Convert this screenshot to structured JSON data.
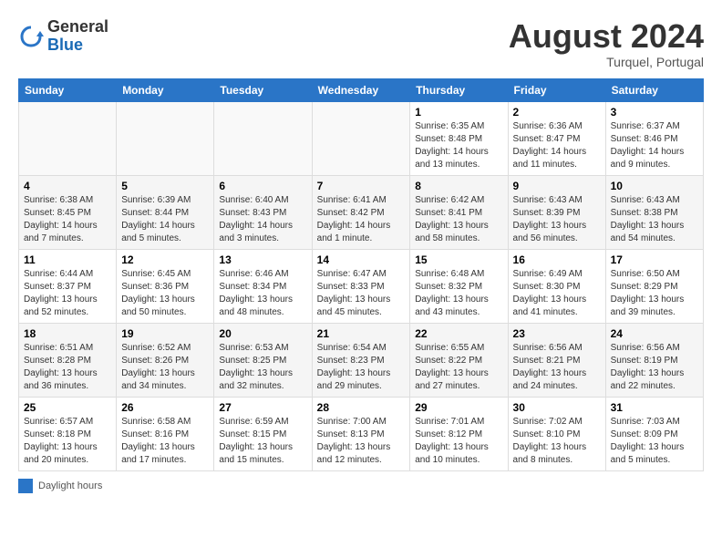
{
  "header": {
    "logo_line1": "General",
    "logo_line2": "Blue",
    "month_year": "August 2024",
    "location": "Turquel, Portugal"
  },
  "calendar": {
    "days_of_week": [
      "Sunday",
      "Monday",
      "Tuesday",
      "Wednesday",
      "Thursday",
      "Friday",
      "Saturday"
    ],
    "weeks": [
      [
        {
          "num": "",
          "info": ""
        },
        {
          "num": "",
          "info": ""
        },
        {
          "num": "",
          "info": ""
        },
        {
          "num": "",
          "info": ""
        },
        {
          "num": "1",
          "info": "Sunrise: 6:35 AM\nSunset: 8:48 PM\nDaylight: 14 hours and 13 minutes."
        },
        {
          "num": "2",
          "info": "Sunrise: 6:36 AM\nSunset: 8:47 PM\nDaylight: 14 hours and 11 minutes."
        },
        {
          "num": "3",
          "info": "Sunrise: 6:37 AM\nSunset: 8:46 PM\nDaylight: 14 hours and 9 minutes."
        }
      ],
      [
        {
          "num": "4",
          "info": "Sunrise: 6:38 AM\nSunset: 8:45 PM\nDaylight: 14 hours and 7 minutes."
        },
        {
          "num": "5",
          "info": "Sunrise: 6:39 AM\nSunset: 8:44 PM\nDaylight: 14 hours and 5 minutes."
        },
        {
          "num": "6",
          "info": "Sunrise: 6:40 AM\nSunset: 8:43 PM\nDaylight: 14 hours and 3 minutes."
        },
        {
          "num": "7",
          "info": "Sunrise: 6:41 AM\nSunset: 8:42 PM\nDaylight: 14 hours and 1 minute."
        },
        {
          "num": "8",
          "info": "Sunrise: 6:42 AM\nSunset: 8:41 PM\nDaylight: 13 hours and 58 minutes."
        },
        {
          "num": "9",
          "info": "Sunrise: 6:43 AM\nSunset: 8:39 PM\nDaylight: 13 hours and 56 minutes."
        },
        {
          "num": "10",
          "info": "Sunrise: 6:43 AM\nSunset: 8:38 PM\nDaylight: 13 hours and 54 minutes."
        }
      ],
      [
        {
          "num": "11",
          "info": "Sunrise: 6:44 AM\nSunset: 8:37 PM\nDaylight: 13 hours and 52 minutes."
        },
        {
          "num": "12",
          "info": "Sunrise: 6:45 AM\nSunset: 8:36 PM\nDaylight: 13 hours and 50 minutes."
        },
        {
          "num": "13",
          "info": "Sunrise: 6:46 AM\nSunset: 8:34 PM\nDaylight: 13 hours and 48 minutes."
        },
        {
          "num": "14",
          "info": "Sunrise: 6:47 AM\nSunset: 8:33 PM\nDaylight: 13 hours and 45 minutes."
        },
        {
          "num": "15",
          "info": "Sunrise: 6:48 AM\nSunset: 8:32 PM\nDaylight: 13 hours and 43 minutes."
        },
        {
          "num": "16",
          "info": "Sunrise: 6:49 AM\nSunset: 8:30 PM\nDaylight: 13 hours and 41 minutes."
        },
        {
          "num": "17",
          "info": "Sunrise: 6:50 AM\nSunset: 8:29 PM\nDaylight: 13 hours and 39 minutes."
        }
      ],
      [
        {
          "num": "18",
          "info": "Sunrise: 6:51 AM\nSunset: 8:28 PM\nDaylight: 13 hours and 36 minutes."
        },
        {
          "num": "19",
          "info": "Sunrise: 6:52 AM\nSunset: 8:26 PM\nDaylight: 13 hours and 34 minutes."
        },
        {
          "num": "20",
          "info": "Sunrise: 6:53 AM\nSunset: 8:25 PM\nDaylight: 13 hours and 32 minutes."
        },
        {
          "num": "21",
          "info": "Sunrise: 6:54 AM\nSunset: 8:23 PM\nDaylight: 13 hours and 29 minutes."
        },
        {
          "num": "22",
          "info": "Sunrise: 6:55 AM\nSunset: 8:22 PM\nDaylight: 13 hours and 27 minutes."
        },
        {
          "num": "23",
          "info": "Sunrise: 6:56 AM\nSunset: 8:21 PM\nDaylight: 13 hours and 24 minutes."
        },
        {
          "num": "24",
          "info": "Sunrise: 6:56 AM\nSunset: 8:19 PM\nDaylight: 13 hours and 22 minutes."
        }
      ],
      [
        {
          "num": "25",
          "info": "Sunrise: 6:57 AM\nSunset: 8:18 PM\nDaylight: 13 hours and 20 minutes."
        },
        {
          "num": "26",
          "info": "Sunrise: 6:58 AM\nSunset: 8:16 PM\nDaylight: 13 hours and 17 minutes."
        },
        {
          "num": "27",
          "info": "Sunrise: 6:59 AM\nSunset: 8:15 PM\nDaylight: 13 hours and 15 minutes."
        },
        {
          "num": "28",
          "info": "Sunrise: 7:00 AM\nSunset: 8:13 PM\nDaylight: 13 hours and 12 minutes."
        },
        {
          "num": "29",
          "info": "Sunrise: 7:01 AM\nSunset: 8:12 PM\nDaylight: 13 hours and 10 minutes."
        },
        {
          "num": "30",
          "info": "Sunrise: 7:02 AM\nSunset: 8:10 PM\nDaylight: 13 hours and 8 minutes."
        },
        {
          "num": "31",
          "info": "Sunrise: 7:03 AM\nSunset: 8:09 PM\nDaylight: 13 hours and 5 minutes."
        }
      ]
    ]
  },
  "legend": {
    "label": "Daylight hours"
  }
}
